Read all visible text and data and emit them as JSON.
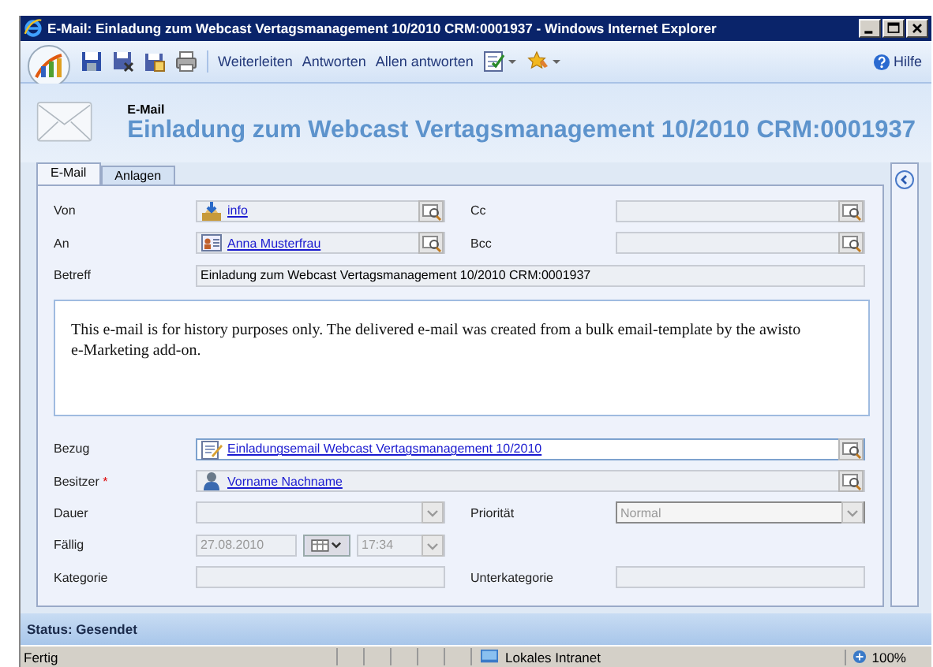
{
  "window": {
    "title": "E-Mail: Einladung zum Webcast Vertagsmanagement 10/2010 CRM:0001937 - Windows Internet Explorer"
  },
  "toolbar": {
    "icon_buttons": [
      {
        "kind": "save"
      },
      {
        "kind": "save-close"
      },
      {
        "kind": "save-new"
      },
      {
        "kind": "print"
      }
    ],
    "text_buttons": [
      "Weiterleiten",
      "Antworten",
      "Allen antworten"
    ],
    "menu_buttons": [
      {
        "kind": "checklist"
      },
      {
        "kind": "star"
      }
    ],
    "help": "Hilfe"
  },
  "header": {
    "entity": "E-Mail",
    "title": "Einladung zum Webcast Vertagsmanagement 10/2010 CRM:0001937"
  },
  "tabs": [
    {
      "label": "E-Mail",
      "selected": true
    },
    {
      "label": "Anlagen",
      "selected": false
    }
  ],
  "form": {
    "rows": [
      {
        "kind": "pair",
        "left": {
          "label": "Von",
          "kind": "lookup",
          "value": "info",
          "disabled": true
        },
        "right": {
          "label": "Cc",
          "kind": "lookup",
          "disabled": true
        }
      },
      {
        "kind": "pair",
        "left": {
          "label": "An",
          "kind": "lookup",
          "value": "Anna Musterfrau",
          "disabled": true
        },
        "right": {
          "label": "Bcc",
          "kind": "lookup",
          "disabled": true
        }
      },
      {
        "kind": "wide",
        "field": {
          "label": "Betreff",
          "kind": "text",
          "value": "Einladung zum Webcast Vertagsmanagement 10/2010 CRM:0001937",
          "disabled": true
        }
      },
      {
        "kind": "body",
        "text": "This e-mail is for history purposes only. The delivered e-mail was created from a bulk email-template by the awisto e-Marketing add-on."
      },
      {
        "kind": "wide",
        "field": {
          "label": "Bezug",
          "kind": "lookup",
          "value": "Einladungsemail Webcast Vertagsmanagement 10/2010",
          "disabled": false
        }
      },
      {
        "kind": "wide",
        "field": {
          "label": "Besitzer",
          "required_mark": "*",
          "kind": "lookup",
          "value": "Vorname Nachname",
          "disabled": true
        }
      },
      {
        "kind": "pair",
        "left": {
          "label": "Dauer",
          "kind": "select",
          "disabled": true
        },
        "right": {
          "label": "Priorität",
          "kind": "select",
          "value": "Normal",
          "disabled": true
        }
      },
      {
        "kind": "pair",
        "left": {
          "label": "Fällig",
          "kind": "date",
          "value": "27.08.2010",
          "time": "17:34",
          "disabled": true
        }
      },
      {
        "kind": "pair",
        "left": {
          "label": "Kategorie",
          "kind": "text",
          "disabled": true
        },
        "right": {
          "label": "Unterkategorie",
          "kind": "text",
          "disabled": true
        }
      }
    ]
  },
  "status": "Status: Gesendet",
  "ie_status": {
    "text": "Fertig",
    "zone": "Lokales Intranet",
    "zoom": "100%"
  }
}
